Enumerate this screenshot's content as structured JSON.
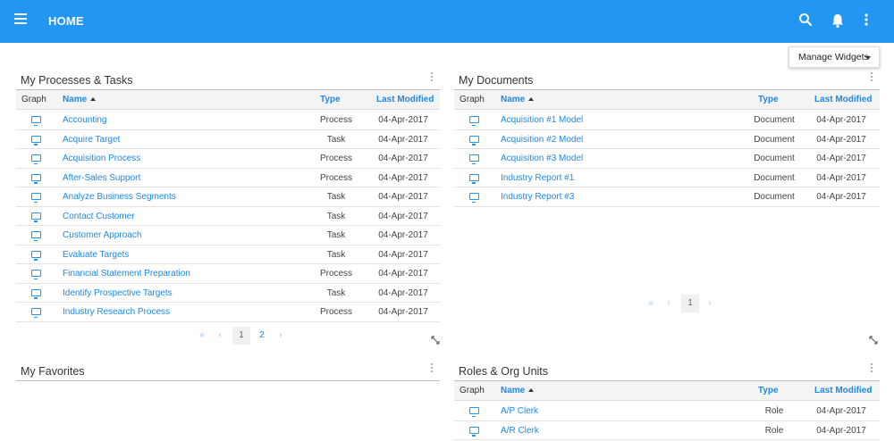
{
  "header": {
    "title": "HOME"
  },
  "toolbar": {
    "manage_widgets": "Manage Widgets"
  },
  "columns": {
    "graph": "Graph",
    "name": "Name",
    "type": "Type",
    "last_modified": "Last Modified"
  },
  "processes": {
    "title": "My Processes & Tasks",
    "rows": [
      {
        "name": "Accounting",
        "type": "Process",
        "date": "04-Apr-2017"
      },
      {
        "name": "Acquire Target",
        "type": "Task",
        "date": "04-Apr-2017"
      },
      {
        "name": "Acquisition Process",
        "type": "Process",
        "date": "04-Apr-2017"
      },
      {
        "name": "After-Sales Support",
        "type": "Process",
        "date": "04-Apr-2017"
      },
      {
        "name": "Analyze Business Segments",
        "type": "Task",
        "date": "04-Apr-2017"
      },
      {
        "name": "Contact Customer",
        "type": "Task",
        "date": "04-Apr-2017"
      },
      {
        "name": "Customer Approach",
        "type": "Task",
        "date": "04-Apr-2017"
      },
      {
        "name": "Evaluate Targets",
        "type": "Task",
        "date": "04-Apr-2017"
      },
      {
        "name": "Financial Statement Preparation",
        "type": "Process",
        "date": "04-Apr-2017"
      },
      {
        "name": "Identify Prospective Targets",
        "type": "Task",
        "date": "04-Apr-2017"
      },
      {
        "name": "Industry Research Process",
        "type": "Process",
        "date": "04-Apr-2017"
      }
    ],
    "pager": {
      "first": "«",
      "prev": "‹",
      "current": "1",
      "page2": "2",
      "next": "›"
    }
  },
  "documents": {
    "title": "My Documents",
    "rows": [
      {
        "name": "Acquisition #1 Model",
        "type": "Document",
        "date": "04-Apr-2017"
      },
      {
        "name": "Acquisition #2 Model",
        "type": "Document",
        "date": "04-Apr-2017"
      },
      {
        "name": "Acquisition #3 Model",
        "type": "Document",
        "date": "04-Apr-2017"
      },
      {
        "name": "Industry Report #1",
        "type": "Document",
        "date": "04-Apr-2017"
      },
      {
        "name": "Industry Report #3",
        "type": "Document",
        "date": "04-Apr-2017"
      }
    ],
    "pager": {
      "first": "«",
      "prev": "‹",
      "current": "1",
      "next": "›"
    }
  },
  "favorites": {
    "title": "My Favorites"
  },
  "roles": {
    "title": "Roles & Org Units",
    "rows": [
      {
        "name": "A/P Clerk",
        "type": "Role",
        "date": "04-Apr-2017"
      },
      {
        "name": "A/R Clerk",
        "type": "Role",
        "date": "04-Apr-2017"
      }
    ]
  },
  "colors": {
    "primary": "#2196f3",
    "link": "#1e88e5"
  },
  "icons": [
    "menu-icon",
    "search-icon",
    "bell-icon",
    "more-vert-icon",
    "monitor-icon",
    "expand-icon"
  ]
}
